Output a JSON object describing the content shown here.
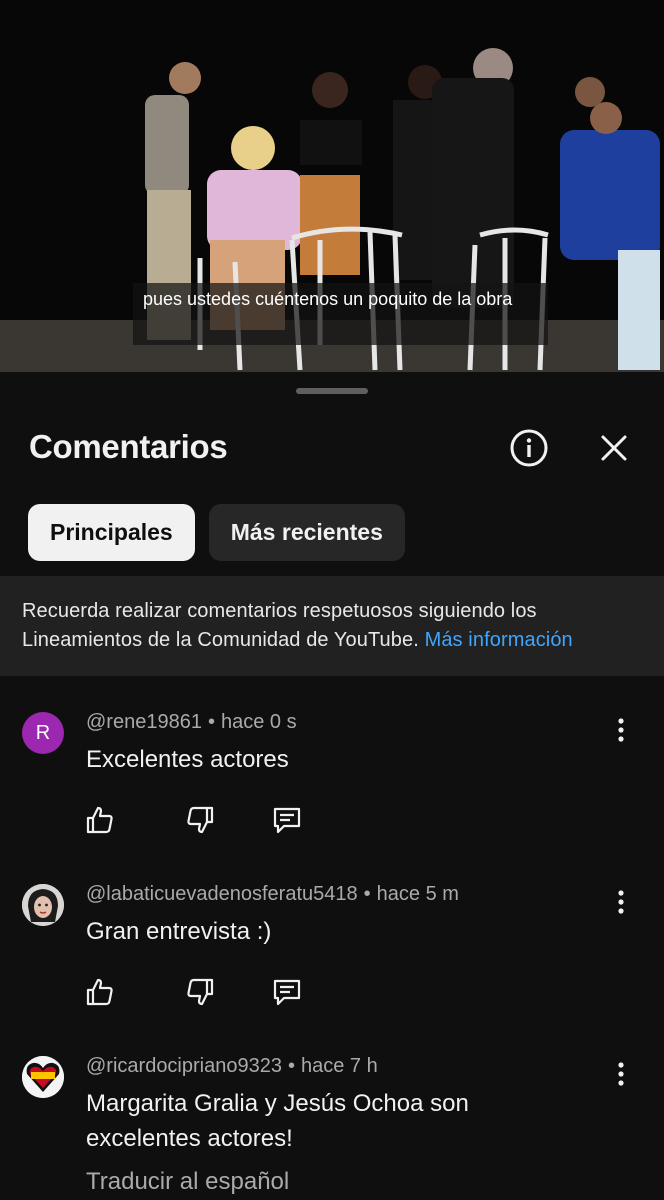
{
  "video": {
    "caption": "pues ustedes cuéntenos un poquito de la obra"
  },
  "sheet": {
    "title": "Comentarios",
    "tabs": [
      {
        "label": "Principales",
        "active": true
      },
      {
        "label": "Más recientes",
        "active": false
      }
    ],
    "notice": {
      "text": "Recuerda realizar comentarios respetuosos siguiendo los Lineamientos de la Comunidad de YouTube.",
      "link": "Más información"
    }
  },
  "comments": [
    {
      "avatar_letter": "R",
      "author": "@rene19861",
      "time": "hace 0 s",
      "text": "Excelentes actores"
    },
    {
      "avatar_letter": "",
      "author": "@labaticuevadenosferatu5418",
      "time": "hace 5 m",
      "text": "Gran entrevista :)"
    },
    {
      "avatar_letter": "",
      "author": "@ricardocipriano9323",
      "time": "hace 7 h",
      "text": "Margarita Gralia y Jesús Ochoa son excelentes actores!",
      "translate": "Traducir al español"
    }
  ],
  "separator": "•",
  "colors": {
    "background": "#0f0f0f",
    "link": "#3ea6ff",
    "chip_active_bg": "#f1f1f1",
    "chip_inactive_bg": "#272727",
    "avatar_r": "#9c27b0"
  },
  "icons": [
    "info-icon",
    "close-icon",
    "more-vert-icon",
    "thumb-up-icon",
    "thumb-down-icon",
    "reply-icon"
  ]
}
